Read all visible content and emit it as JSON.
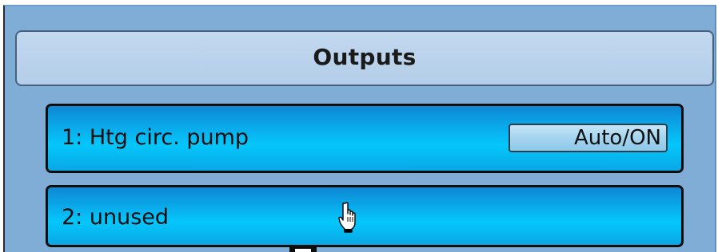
{
  "header": {
    "title": "Outputs"
  },
  "outputs": [
    {
      "label": "1: Htg circ. pump",
      "status": "Auto/ON"
    },
    {
      "label": "2: unused"
    }
  ],
  "colors": {
    "panel_bg": "#7fadd6",
    "header_bg": "#b4cee9",
    "row_bg": "#08b7f2",
    "button_bg": "#a3d4ee"
  },
  "icons": {
    "cursor": "hand-pointer-icon"
  }
}
